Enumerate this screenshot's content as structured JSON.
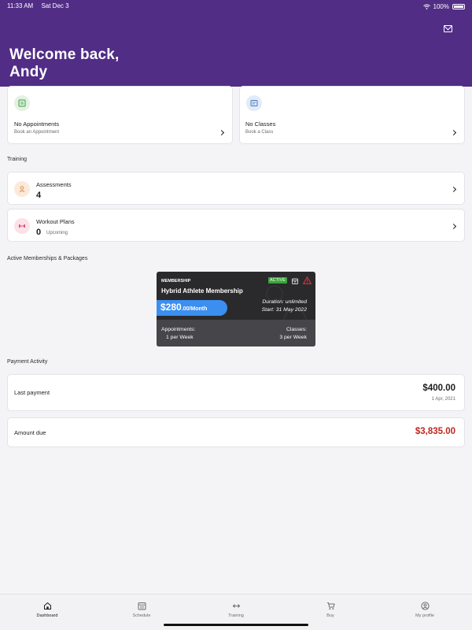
{
  "status": {
    "time": "11:33 AM",
    "date": "Sat Dec 3",
    "battery": "100%"
  },
  "header": {
    "welcome_line1": "Welcome back,",
    "welcome_line2": "Andy"
  },
  "quick": {
    "appointments": {
      "title": "No Appointments",
      "subtitle": "Book an Appointment"
    },
    "classes": {
      "title": "No Classes",
      "subtitle": "Book a Class"
    }
  },
  "training": {
    "section": "Training",
    "assessments": {
      "title": "Assessments",
      "count": "4"
    },
    "workout": {
      "title": "Workout Plans",
      "count": "0",
      "status": "Upcoming"
    }
  },
  "memberships": {
    "section": "Active Memberships & Packages",
    "card": {
      "kicker": "MEMBERSHIP",
      "name": "Hybrid Athlete Membership",
      "badge": "ACTIVE",
      "price_main": "$280",
      "price_rest": ".00/Month",
      "duration": "Duration: unlimited",
      "start": "Start: 31 May 2022",
      "appointments_label": "Appointments:",
      "appointments_value": "1 per Week",
      "classes_label": "Classes:",
      "classes_value": "3 per Week"
    }
  },
  "payments": {
    "section": "Payment Activity",
    "last": {
      "label": "Last payment",
      "amount": "$400.00",
      "date": "1 Apr, 2021"
    },
    "due": {
      "label": "Amount due",
      "amount": "$3,835.00"
    }
  },
  "nav": {
    "dashboard": "Dashboard",
    "schedule": "Schedule",
    "training": "Training",
    "buy": "Buy",
    "profile": "My profile"
  },
  "colors": {
    "brand": "#512d86",
    "accent": "#3b8ff0",
    "due": "#c0261e",
    "active": "#3aa53a"
  }
}
